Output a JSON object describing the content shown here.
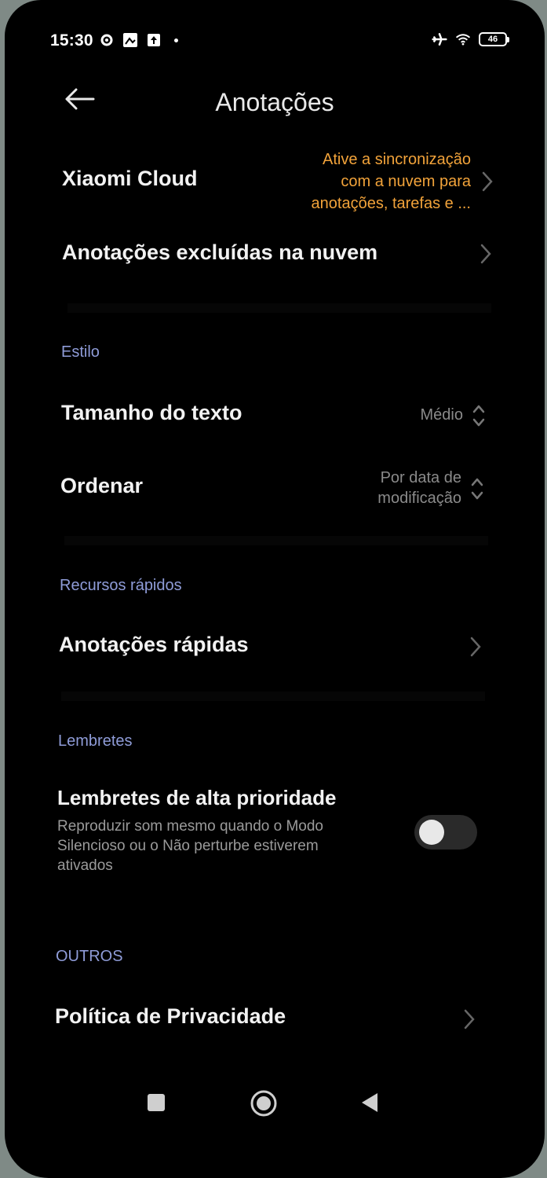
{
  "status_bar": {
    "time": "15:30",
    "battery": "46",
    "icons": [
      "settings-icon",
      "photo-icon",
      "upload-icon",
      "airplane-icon",
      "wifi-icon",
      "battery-icon"
    ]
  },
  "header": {
    "title": "Anotações"
  },
  "cloud": {
    "xiaomi_cloud_label": "Xiaomi Cloud",
    "sync_line1": "Ative a sincronização",
    "sync_line2": "com a nuvem para",
    "sync_line3": "anotações, tarefas e ...",
    "deleted_label": "Anotações excluídas na nuvem"
  },
  "style_section": {
    "header": "Estilo",
    "text_size_label": "Tamanho do texto",
    "text_size_value": "Médio",
    "sort_label": "Ordenar",
    "sort_value_line1": "Por data de",
    "sort_value_line2": "modificação"
  },
  "quick_section": {
    "header": "Recursos rápidos",
    "quick_notes_label": "Anotações rápidas"
  },
  "reminders_section": {
    "header": "Lembretes",
    "priority_label": "Lembretes de alta prioridade",
    "priority_desc_line1": "Reproduzir som mesmo quando o Modo",
    "priority_desc_line2": "Silencioso ou o Não perturbe estiverem",
    "priority_desc_line3": "ativados",
    "priority_enabled": false
  },
  "others_section": {
    "header": "OUTROS",
    "privacy_label": "Política de Privacidade"
  },
  "colors": {
    "background": "#000000",
    "accent_orange": "#f2a33a",
    "section_header": "#8f9cd8",
    "text_primary": "#f2f2f2",
    "text_secondary": "#8a8a8a"
  }
}
